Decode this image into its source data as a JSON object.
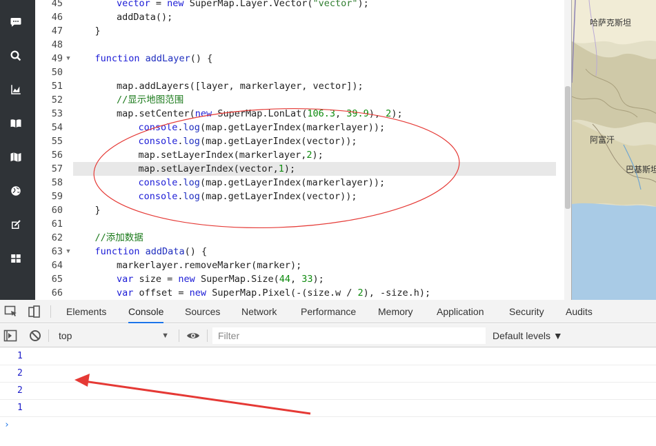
{
  "editor": {
    "lines": [
      {
        "num": "45",
        "fold": "",
        "indent": 2,
        "parts": [
          [
            "kw",
            "vector"
          ],
          [
            "",
            " = "
          ],
          [
            "kw",
            "new"
          ],
          [
            "",
            " SuperMap.Layer.Vector("
          ],
          [
            "str",
            "\"vector\""
          ],
          [
            "",
            ");"
          ]
        ]
      },
      {
        "num": "46",
        "fold": "",
        "indent": 2,
        "parts": [
          [
            "",
            "addData();"
          ]
        ]
      },
      {
        "num": "47",
        "fold": "",
        "indent": 1,
        "parts": [
          [
            "",
            "}"
          ]
        ]
      },
      {
        "num": "48",
        "fold": "",
        "indent": 0,
        "parts": []
      },
      {
        "num": "49",
        "fold": "▼",
        "indent": 1,
        "parts": [
          [
            "kw",
            "function"
          ],
          [
            "",
            " "
          ],
          [
            "fn",
            "addLayer"
          ],
          [
            "",
            "() {"
          ]
        ]
      },
      {
        "num": "50",
        "fold": "",
        "indent": 0,
        "parts": []
      },
      {
        "num": "51",
        "fold": "",
        "indent": 2,
        "parts": [
          [
            "",
            "map.addLayers([layer, markerlayer, vector]);"
          ]
        ]
      },
      {
        "num": "52",
        "fold": "",
        "indent": 2,
        "parts": [
          [
            "cm",
            "//显示地图范围"
          ]
        ]
      },
      {
        "num": "53",
        "fold": "",
        "indent": 2,
        "parts": [
          [
            "",
            "map.setCenter("
          ],
          [
            "kw",
            "new"
          ],
          [
            "",
            " SuperMap.LonLat("
          ],
          [
            "num",
            "106.3"
          ],
          [
            "",
            ", "
          ],
          [
            "num",
            "39.9"
          ],
          [
            "",
            "), "
          ],
          [
            "num",
            "2"
          ],
          [
            "",
            ");"
          ]
        ]
      },
      {
        "num": "54",
        "fold": "",
        "indent": 3,
        "parts": [
          [
            "kw",
            "console"
          ],
          [
            "",
            "."
          ],
          [
            "fn",
            "log"
          ],
          [
            "",
            "(map.getLayerIndex(markerlayer));"
          ]
        ]
      },
      {
        "num": "55",
        "fold": "",
        "indent": 3,
        "parts": [
          [
            "kw",
            "console"
          ],
          [
            "",
            "."
          ],
          [
            "fn",
            "log"
          ],
          [
            "",
            "(map.getLayerIndex(vector));"
          ]
        ]
      },
      {
        "num": "56",
        "fold": "",
        "indent": 3,
        "parts": [
          [
            "",
            "map.setLayerIndex(markerlayer,"
          ],
          [
            "num",
            "2"
          ],
          [
            "",
            ");"
          ]
        ]
      },
      {
        "num": "57",
        "fold": "",
        "indent": 3,
        "active": true,
        "parts": [
          [
            "",
            "map.setLayerIndex(vector,"
          ],
          [
            "num",
            "1"
          ],
          [
            "",
            ");"
          ]
        ]
      },
      {
        "num": "58",
        "fold": "",
        "indent": 3,
        "parts": [
          [
            "kw",
            "console"
          ],
          [
            "",
            "."
          ],
          [
            "fn",
            "log"
          ],
          [
            "",
            "(map.getLayerIndex(markerlayer));"
          ]
        ]
      },
      {
        "num": "59",
        "fold": "",
        "indent": 3,
        "parts": [
          [
            "kw",
            "console"
          ],
          [
            "",
            "."
          ],
          [
            "fn",
            "log"
          ],
          [
            "",
            "(map.getLayerIndex(vector));"
          ]
        ]
      },
      {
        "num": "60",
        "fold": "",
        "indent": 1,
        "parts": [
          [
            "",
            "}"
          ]
        ]
      },
      {
        "num": "61",
        "fold": "",
        "indent": 0,
        "parts": []
      },
      {
        "num": "62",
        "fold": "",
        "indent": 1,
        "parts": [
          [
            "cm",
            "//添加数据"
          ]
        ]
      },
      {
        "num": "63",
        "fold": "▼",
        "indent": 1,
        "parts": [
          [
            "kw",
            "function"
          ],
          [
            "",
            " "
          ],
          [
            "fn",
            "addData"
          ],
          [
            "",
            "() {"
          ]
        ]
      },
      {
        "num": "64",
        "fold": "",
        "indent": 2,
        "parts": [
          [
            "",
            "markerlayer.removeMarker(marker);"
          ]
        ]
      },
      {
        "num": "65",
        "fold": "",
        "indent": 2,
        "parts": [
          [
            "kw",
            "var"
          ],
          [
            "",
            " size = "
          ],
          [
            "kw",
            "new"
          ],
          [
            "",
            " SuperMap.Size("
          ],
          [
            "num",
            "44"
          ],
          [
            "",
            ", "
          ],
          [
            "num",
            "33"
          ],
          [
            "",
            ");"
          ]
        ]
      },
      {
        "num": "66",
        "fold": "",
        "indent": 2,
        "parts": [
          [
            "kw",
            "var"
          ],
          [
            "",
            " offset = "
          ],
          [
            "kw",
            "new"
          ],
          [
            "",
            " SuperMap.Pixel(-(size.w / "
          ],
          [
            "num",
            "2"
          ],
          [
            "",
            "), -size.h);"
          ]
        ]
      }
    ]
  },
  "map": {
    "labels": [
      "哈萨克斯坦",
      "阿富汗",
      "巴基斯坦"
    ]
  },
  "devtools": {
    "tabs": [
      "Elements",
      "Console",
      "Sources",
      "Network",
      "Performance",
      "Memory",
      "Application",
      "Security",
      "Audits"
    ],
    "active_tab": "Console",
    "context": "top",
    "filter_placeholder": "Filter",
    "levels_label": "Default levels ▼",
    "logs": [
      "1",
      "2",
      "2",
      "1"
    ],
    "prompt": "›"
  },
  "colors": {
    "accent": "#1a73e8",
    "annotation": "#e53935"
  }
}
